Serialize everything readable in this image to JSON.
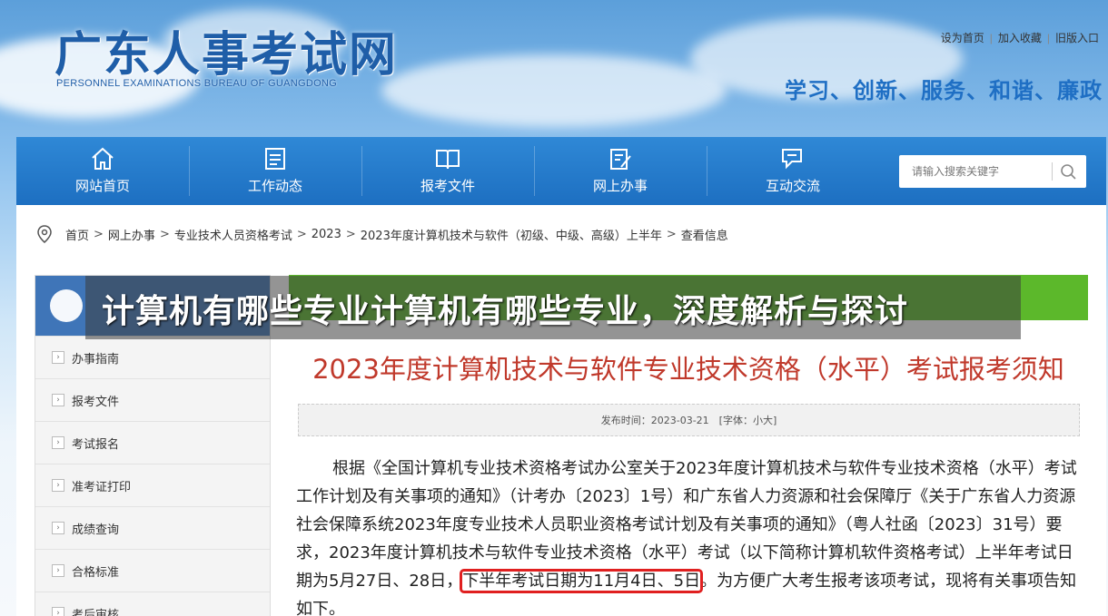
{
  "header": {
    "logo_cn": "广东人事考试网",
    "logo_en": "PERSONNEL EXAMINATIONS BUREAU OF GUANGDONG",
    "top_links": [
      "设为首页",
      "加入收藏",
      "旧版入口"
    ],
    "slogan": "学习、创新、服务、和谐、廉政"
  },
  "nav": {
    "items": [
      {
        "label": "网站首页",
        "icon": "home-icon"
      },
      {
        "label": "工作动态",
        "icon": "list-icon"
      },
      {
        "label": "报考文件",
        "icon": "book-icon"
      },
      {
        "label": "网上办事",
        "icon": "edit-doc-icon"
      },
      {
        "label": "互动交流",
        "icon": "chat-icon"
      }
    ],
    "search_placeholder": "请输入搜索关键字"
  },
  "breadcrumb": [
    "首页",
    "网上办事",
    "专业技术人员资格考试",
    "2023",
    "2023年度计算机技术与软件（初级、中级、高级）上半年",
    "查看信息"
  ],
  "sidebar": {
    "items": [
      "办事指南",
      "报考文件",
      "考试报名",
      "准考证打印",
      "成绩查询",
      "合格标准",
      "考后审核"
    ]
  },
  "overlay": {
    "headline": "计算机有哪些专业计算机有哪些专业，深度解析与探讨"
  },
  "article": {
    "title": "2023年度计算机技术与软件专业技术资格（水平）考试报考须知",
    "meta": "发布时间：2023-03-21　[字体：小大]",
    "body_part1": "根据《全国计算机专业技术资格考试办公室关于2023年度计算机技术与软件专业技术资格（水平）考试工作计划及有关事项的通知》（计考办〔2023〕1号）和广东省人力资源和社会保障厅《关于广东省人力资源社会保障系统2023年度专业技术人员职业资格考试计划及有关事项的通知》（粤人社函〔2023〕31号）要求，2023年度计算机技术与软件专业技术资格（水平）考试（以下简称计算机软件资格考试）上半年考试日期为5月27日、28日，",
    "body_highlight": "下半年考试日期为11月4日、5日",
    "body_part2": "。为方便广大考生报考该项考试，现将有关事项告知如下。"
  },
  "colors": {
    "nav_blue": "#1d6fc1",
    "title_red": "#c0392b",
    "highlight_red": "#e02020",
    "strip_green": "#5cb82b"
  }
}
